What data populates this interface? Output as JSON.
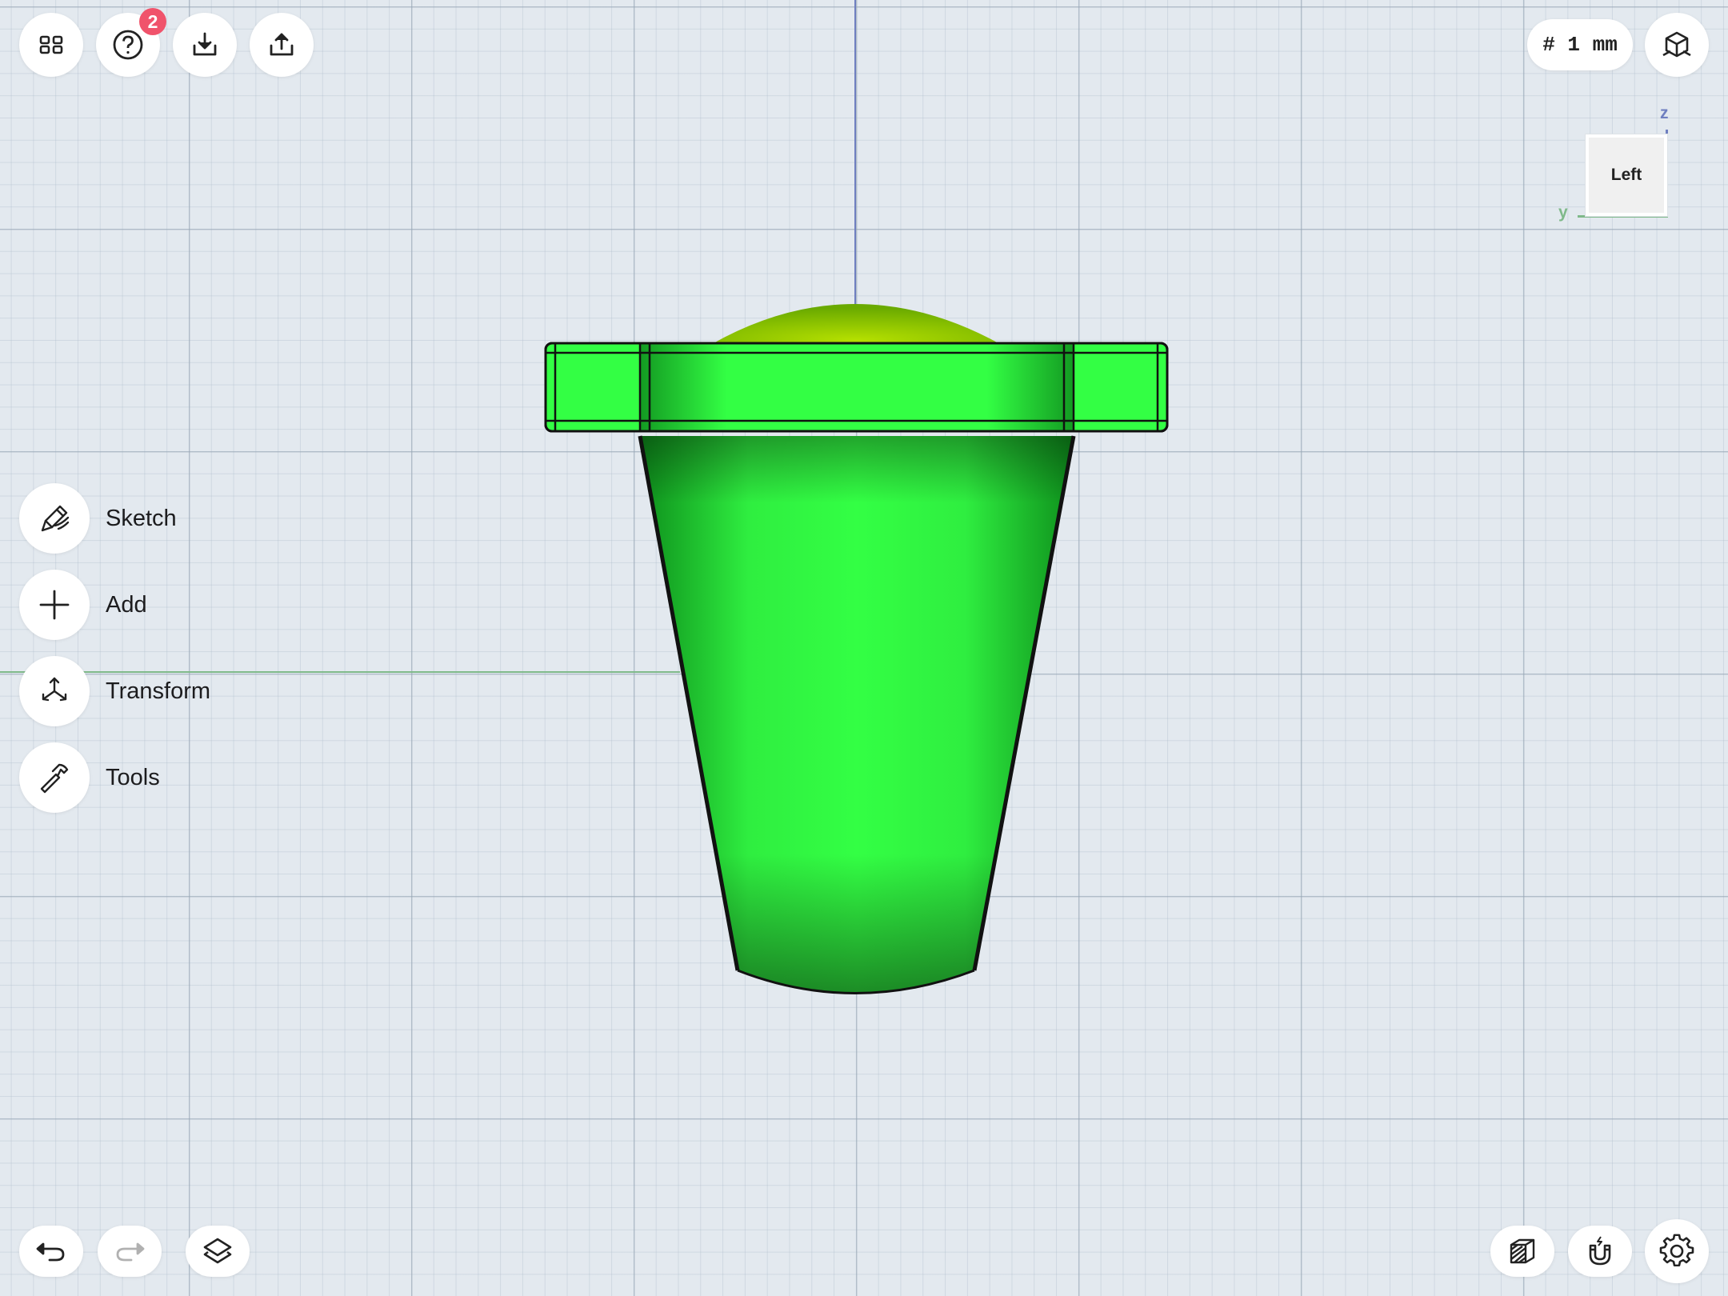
{
  "toolbar": {
    "grid_menu_icon": "grid-icon",
    "help_icon": "help-icon",
    "help_badge": "2",
    "import_icon": "import-icon",
    "export_icon": "share-icon"
  },
  "top_right": {
    "grid_unit": "# 1 mm",
    "view_mode_icon": "cube-icon"
  },
  "view_cube": {
    "face_label": "Left",
    "axis_z": "z",
    "axis_y": "y"
  },
  "side_menu": {
    "items": [
      {
        "label": "Sketch",
        "icon": "pencil-icon"
      },
      {
        "label": "Add",
        "icon": "plus-icon"
      },
      {
        "label": "Transform",
        "icon": "transform-icon"
      },
      {
        "label": "Tools",
        "icon": "hammer-icon"
      }
    ]
  },
  "bottom_left": {
    "undo_icon": "undo-icon",
    "redo_icon": "redo-icon",
    "layers_icon": "layers-icon"
  },
  "bottom_right": {
    "section_icon": "section-view-icon",
    "snap_icon": "magnet-icon",
    "settings_icon": "gear-icon"
  },
  "model": {
    "body_color": "#33ff44",
    "cap_color": "#8ad400",
    "axis_z_color": "#6f7fc0",
    "axis_y_color": "#7fb98a"
  }
}
